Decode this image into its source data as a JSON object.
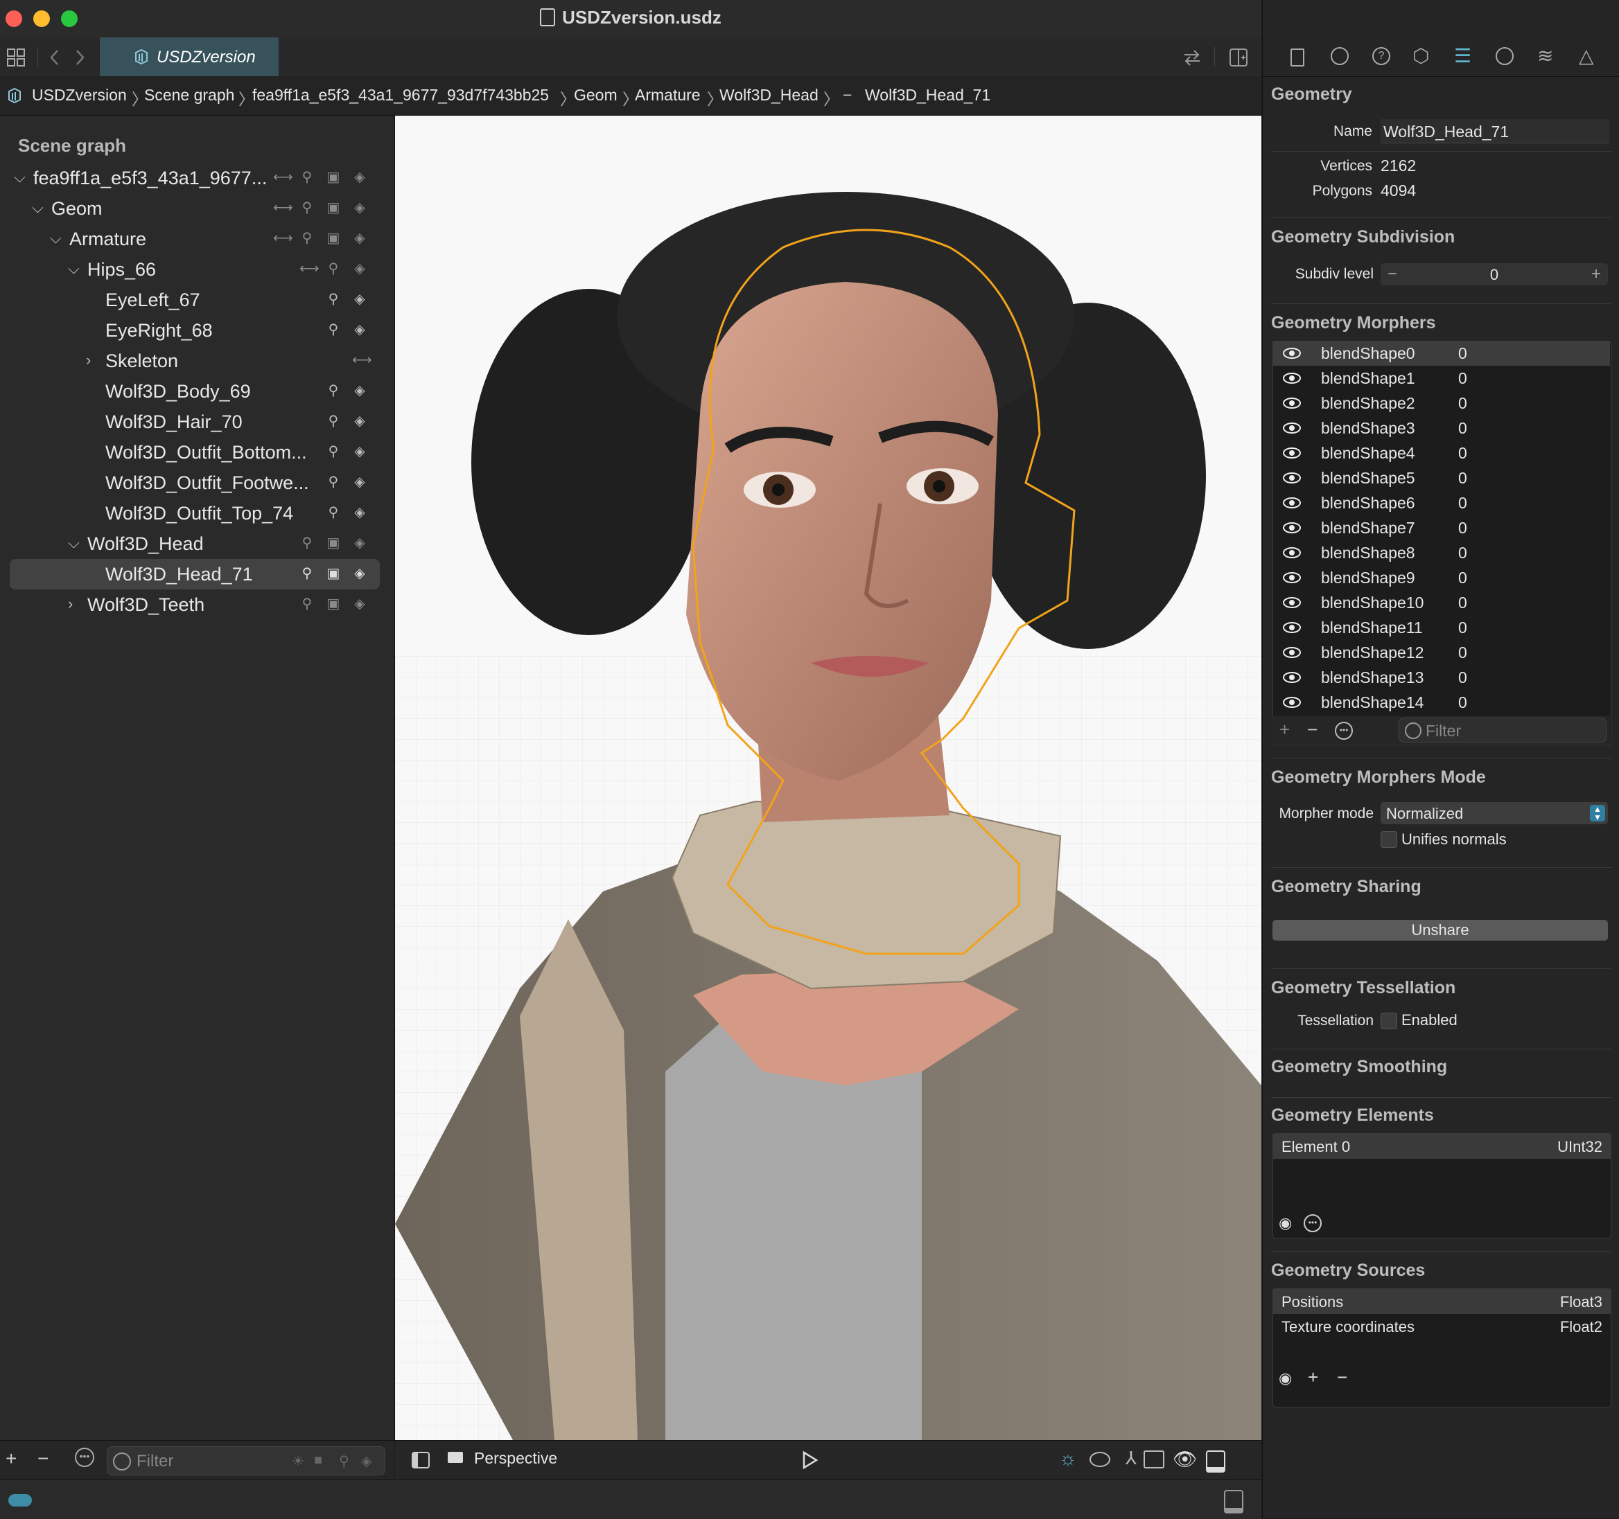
{
  "window": {
    "title": "USDZversion.usdz"
  },
  "toolbar": {
    "tab_label": "USDZversion"
  },
  "breadcrumb": [
    "USDZversion",
    "Scene graph",
    "fea9ff1a_e5f3_43a1_9677_93d7f743bb25",
    "Geom",
    "Armature",
    "Wolf3D_Head",
    "Wolf3D_Head_71"
  ],
  "scene_graph": {
    "title": "Scene graph",
    "items": [
      {
        "label": "fea9ff1a_e5f3_43a1_9677..."
      },
      {
        "label": "Geom"
      },
      {
        "label": "Armature"
      },
      {
        "label": "Hips_66"
      },
      {
        "label": "EyeLeft_67"
      },
      {
        "label": "EyeRight_68"
      },
      {
        "label": "Skeleton"
      },
      {
        "label": "Wolf3D_Body_69"
      },
      {
        "label": "Wolf3D_Hair_70"
      },
      {
        "label": "Wolf3D_Outfit_Bottom..."
      },
      {
        "label": "Wolf3D_Outfit_Footwe..."
      },
      {
        "label": "Wolf3D_Outfit_Top_74"
      },
      {
        "label": "Wolf3D_Head"
      },
      {
        "label": "Wolf3D_Head_71"
      },
      {
        "label": "Wolf3D_Teeth"
      }
    ],
    "filter_placeholder": "Filter"
  },
  "viewport": {
    "camera_label": "Perspective"
  },
  "inspector": {
    "geometry": {
      "title": "Geometry",
      "name_label": "Name",
      "name_value": "Wolf3D_Head_71",
      "vertices_label": "Vertices",
      "vertices": "2162",
      "polygons_label": "Polygons",
      "polygons": "4094"
    },
    "subdivision": {
      "title": "Geometry Subdivision",
      "label": "Subdiv level",
      "value": "0"
    },
    "morphers": {
      "title": "Geometry Morphers",
      "items": [
        {
          "name": "blendShape0",
          "value": "0"
        },
        {
          "name": "blendShape1",
          "value": "0"
        },
        {
          "name": "blendShape2",
          "value": "0"
        },
        {
          "name": "blendShape3",
          "value": "0"
        },
        {
          "name": "blendShape4",
          "value": "0"
        },
        {
          "name": "blendShape5",
          "value": "0"
        },
        {
          "name": "blendShape6",
          "value": "0"
        },
        {
          "name": "blendShape7",
          "value": "0"
        },
        {
          "name": "blendShape8",
          "value": "0"
        },
        {
          "name": "blendShape9",
          "value": "0"
        },
        {
          "name": "blendShape10",
          "value": "0"
        },
        {
          "name": "blendShape11",
          "value": "0"
        },
        {
          "name": "blendShape12",
          "value": "0"
        },
        {
          "name": "blendShape13",
          "value": "0"
        },
        {
          "name": "blendShape14",
          "value": "0"
        }
      ],
      "filter_placeholder": "Filter"
    },
    "morphers_mode": {
      "title": "Geometry Morphers Mode",
      "label": "Morpher mode",
      "value": "Normalized",
      "checkbox_label": "Unifies normals"
    },
    "sharing": {
      "title": "Geometry Sharing",
      "button": "Unshare"
    },
    "tessellation": {
      "title": "Geometry Tessellation",
      "label": "Tessellation",
      "checkbox_label": "Enabled"
    },
    "smoothing": {
      "title": "Geometry Smoothing"
    },
    "elements": {
      "title": "Geometry Elements",
      "rows": [
        {
          "name": "Element 0",
          "type": "UInt32"
        }
      ]
    },
    "sources": {
      "title": "Geometry Sources",
      "rows": [
        {
          "name": "Positions",
          "type": "Float3"
        },
        {
          "name": "Texture coordinates",
          "type": "Float2"
        }
      ]
    }
  },
  "colors": {
    "accent": "#37525a",
    "selection_outline": "#f2a31b",
    "close": "#fe5f57",
    "minimize": "#febc2e",
    "zoom": "#28c840"
  }
}
